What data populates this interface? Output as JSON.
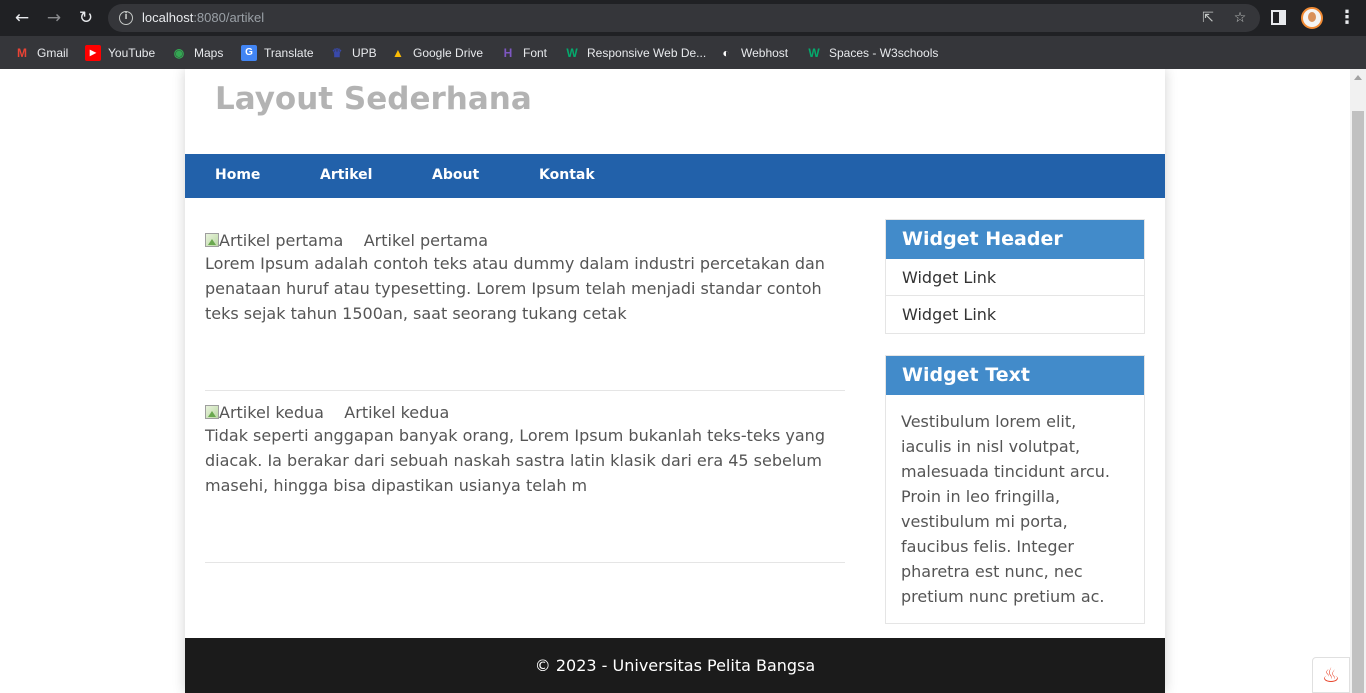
{
  "browser": {
    "url_host": "localhost",
    "url_rest": ":8080/artikel",
    "back_glyph": "←",
    "forward_glyph": "→",
    "reload_glyph": "↻",
    "share_glyph": "⇱",
    "star_glyph": "☆",
    "menu_glyph": "⋮",
    "info_glyph": "i",
    "bookmarks": [
      {
        "label": "Gmail",
        "icon": "gmail-icon",
        "glyph": "M",
        "color": "#ea4335"
      },
      {
        "label": "YouTube",
        "icon": "youtube-icon",
        "glyph": "▶",
        "color": "#ff0000"
      },
      {
        "label": "Maps",
        "icon": "maps-icon",
        "glyph": "◉",
        "color": "#34a853"
      },
      {
        "label": "Translate",
        "icon": "translate-icon",
        "glyph": "G",
        "color": "#4285f4"
      },
      {
        "label": "UPB",
        "icon": "upb-icon",
        "glyph": "♛",
        "color": "#3949ab"
      },
      {
        "label": "Google Drive",
        "icon": "drive-icon",
        "glyph": "▲",
        "color": "#fbbc04"
      },
      {
        "label": "Font",
        "icon": "font-icon",
        "glyph": "H",
        "color": "#7e57c2"
      },
      {
        "label": "Responsive Web De...",
        "icon": "w3schools-icon",
        "glyph": "W",
        "color": "#04aa6d"
      },
      {
        "label": "Webhost",
        "icon": "webhost-icon",
        "glyph": "◐",
        "color": "#ffffff"
      },
      {
        "label": "Spaces - W3schools",
        "icon": "w3schools-icon",
        "glyph": "W",
        "color": "#04aa6d"
      }
    ]
  },
  "site": {
    "title": "Layout Sederhana",
    "nav": [
      "Home",
      "Artikel",
      "About",
      "Kontak"
    ],
    "articles": [
      {
        "img_alt": "Artikel pertama",
        "title": "Artikel pertama",
        "text": "Lorem Ipsum adalah contoh teks atau dummy dalam industri percetakan dan penataan huruf atau typesetting. Lorem Ipsum telah menjadi standar contoh teks sejak tahun 1500an, saat seorang tukang cetak"
      },
      {
        "img_alt": "Artikel kedua",
        "title": "Artikel kedua",
        "text": "Tidak seperti anggapan banyak orang, Lorem Ipsum bukanlah teks-teks yang diacak. Ia berakar dari sebuah naskah sastra latin klasik dari era 45 sebelum masehi, hingga bisa dipastikan usianya telah m"
      }
    ],
    "widgets": {
      "links_header": "Widget Header",
      "links": [
        "Widget Link",
        "Widget Link"
      ],
      "text_header": "Widget Text",
      "text": "Vestibulum lorem elit, iaculis in nisl volutpat, malesuada tincidunt arcu. Proin in leo fringilla, vestibulum mi porta, faucibus felis. Integer pharetra est nunc, nec pretium nunc pretium ac."
    },
    "footer": "© 2023 - Universitas Pelita Bangsa",
    "fire_glyph": "♨"
  },
  "colors": {
    "nav_bg": "#2261aa",
    "widget_header_bg": "#428bca",
    "footer_bg": "#1b1b1b",
    "title_color": "#b3b3b3"
  }
}
